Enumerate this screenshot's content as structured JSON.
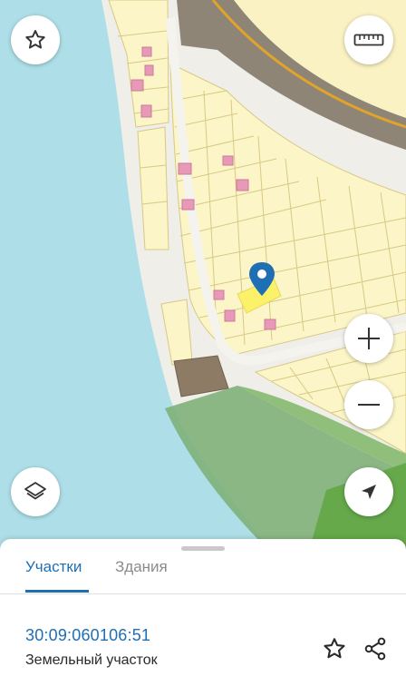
{
  "map": {
    "controls": [
      {
        "icon": "star-outline-icon"
      },
      {
        "icon": "ruler-icon"
      },
      {
        "icon": "plus-icon"
      },
      {
        "icon": "minus-icon"
      },
      {
        "icon": "layers-icon"
      },
      {
        "icon": "navigation-arrow-icon"
      }
    ],
    "marker_icon": "location-pin-icon",
    "colors": {
      "water": "#aedfe8",
      "parcel_fill": "#fbf5c7",
      "parcel_stroke": "#d8c983",
      "selected_parcel": "#fbf26a",
      "road": "#efeee8",
      "highway": "#8f8576",
      "forest": "#7fb07a",
      "building": "#e799b7",
      "marker": "#1e6fb4"
    }
  },
  "sheet": {
    "tabs": [
      {
        "label": "Участки",
        "active": true
      },
      {
        "label": "Здания",
        "active": false
      }
    ],
    "cadastral_number": "30:09:060106:51",
    "parcel_type": "Земельный участок",
    "actions": [
      {
        "icon": "star-outline-icon"
      },
      {
        "icon": "share-icon"
      }
    ],
    "accent_color": "#1e6fb4"
  }
}
